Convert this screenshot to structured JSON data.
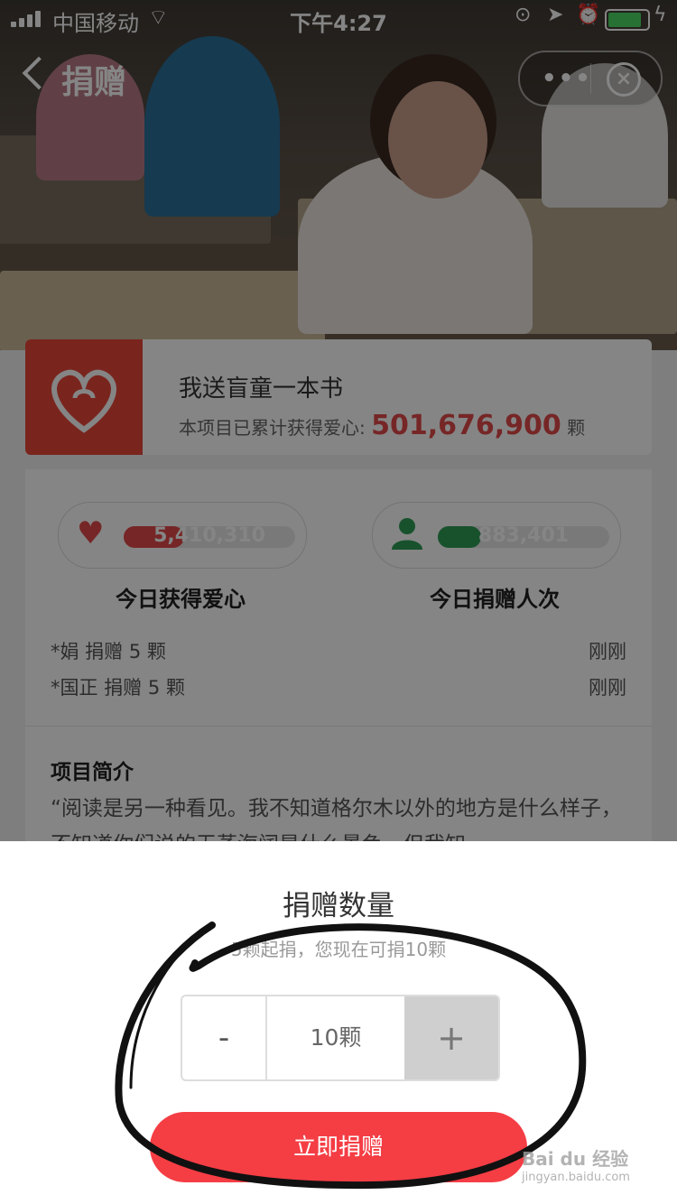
{
  "status_bar": {
    "carrier": "中国移动",
    "time": "下午4:27",
    "battery_level": 0.9
  },
  "nav": {
    "title": "捐赠"
  },
  "project": {
    "title": "我送盲童一本书",
    "total_label": "本项目已累计获得爱心:",
    "total_value": "501,676,900",
    "total_unit": "颗"
  },
  "stats": {
    "hearts": {
      "value": "5,410,310",
      "label": "今日获得爱心",
      "fill": 0.35
    },
    "donors": {
      "value": "883,401",
      "label": "今日捐赠人次",
      "fill": 0.25
    }
  },
  "recent_donations": [
    {
      "text": "*娟 捐赠 5 颗",
      "time": "刚刚"
    },
    {
      "text": "*国正 捐赠 5 颗",
      "time": "刚刚"
    }
  ],
  "intro": {
    "title": "项目简介",
    "text": "“阅读是另一种看见。我不知道格尔木以外的地方是什么样子，不知道你们说的无蒸海阔是什么景色，但我知"
  },
  "donate_sheet": {
    "title": "捐赠数量",
    "subtitle": "5颗起捐，您现在可捐10颗",
    "minus": "-",
    "quantity": "10颗",
    "plus": "+",
    "button": "立即捐赠"
  },
  "watermark": {
    "line1": "Bai du 经验",
    "line2": "jingyan.baidu.com"
  },
  "colors": {
    "accent": "#f53d44",
    "heart": "#e24a4a",
    "person": "#2e9d57"
  }
}
